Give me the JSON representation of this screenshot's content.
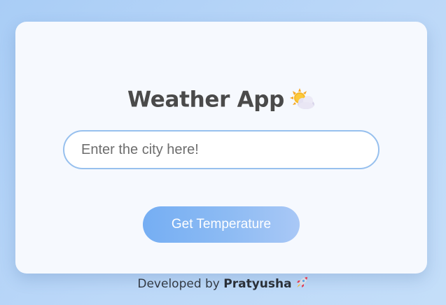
{
  "app": {
    "title": "Weather App",
    "title_icon": "sun-behind-cloud-icon"
  },
  "search": {
    "value": "",
    "placeholder": "Enter the city here!"
  },
  "actions": {
    "get_temperature_label": "Get Temperature"
  },
  "footer": {
    "prefix": "Developed by ",
    "author": "Pratyusha",
    "icon": "rocket-icon"
  },
  "colors": {
    "background_start": "#a9cdf6",
    "card_background": "#f6f9fe",
    "title_text": "#4a4a4a",
    "input_border": "#97c0ee",
    "button_gradient_start": "#75aef3",
    "button_gradient_end": "#a9c8f6",
    "button_text": "#ffffff"
  }
}
